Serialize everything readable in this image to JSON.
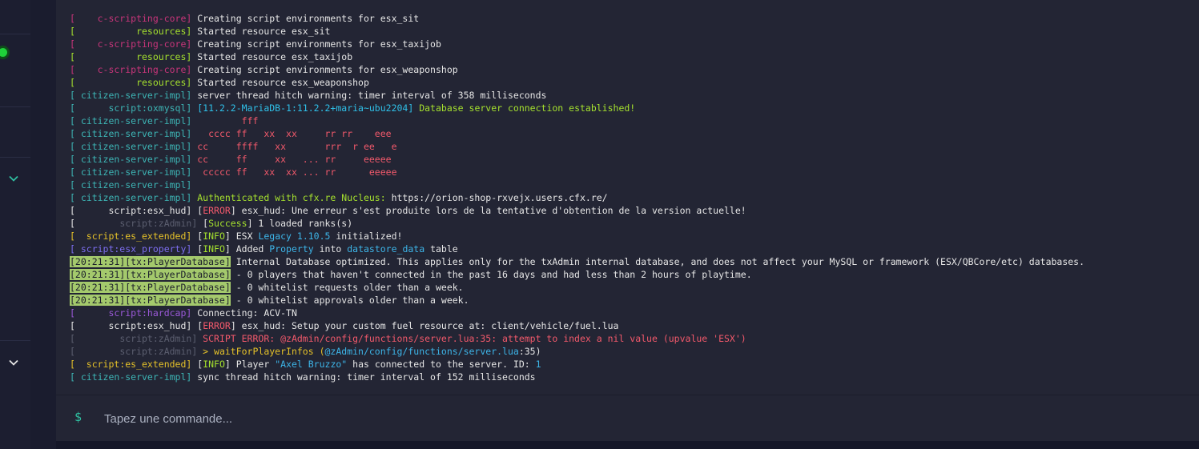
{
  "colors": {
    "background": "#1a1c2e",
    "console_bg": "#232534",
    "status_online": "#1fd13a",
    "tx_badge_bg": "#a4c96c"
  },
  "sidebar": {
    "icons": [
      "status-online-dot",
      "chevron-down-icon",
      "chevron-down-icon"
    ]
  },
  "console": {
    "lines": [
      [
        {
          "t": "[    c-scripting-core]",
          "c": "#c8357a"
        },
        {
          "t": " Creating script environments for esx_sit",
          "c": "#e6e6e6"
        }
      ],
      [
        {
          "t": "[           resources]",
          "c": "#a6e22e"
        },
        {
          "t": " Started resource esx_sit",
          "c": "#e6e6e6"
        }
      ],
      [
        {
          "t": "[    c-scripting-core]",
          "c": "#c8357a"
        },
        {
          "t": " Creating script environments for esx_taxijob",
          "c": "#e6e6e6"
        }
      ],
      [
        {
          "t": "[           resources]",
          "c": "#a6e22e"
        },
        {
          "t": " Started resource esx_taxijob",
          "c": "#e6e6e6"
        }
      ],
      [
        {
          "t": "[    c-scripting-core]",
          "c": "#c8357a"
        },
        {
          "t": " Creating script environments for esx_weaponshop",
          "c": "#e6e6e6"
        }
      ],
      [
        {
          "t": "[           resources]",
          "c": "#a6e22e"
        },
        {
          "t": " Started resource esx_weaponshop",
          "c": "#e6e6e6"
        }
      ],
      [
        {
          "t": "[ citizen-server-impl]",
          "c": "#3db5b5"
        },
        {
          "t": " server thread hitch warning: timer interval of 358 milliseconds",
          "c": "#e6e6e6"
        }
      ],
      [
        {
          "t": "[      script:oxmysql]",
          "c": "#3db5b5"
        },
        {
          "t": " [11.2.2-MariaDB-1:11.2.2+maria~ubu2204]",
          "c": "#2fc0e8"
        },
        {
          "t": " Database server connection established!",
          "c": "#a6e22e"
        }
      ],
      [
        {
          "t": "[ citizen-server-impl]",
          "c": "#3db5b5"
        },
        {
          "t": "         fff",
          "c": "#f2596b"
        }
      ],
      [
        {
          "t": "[ citizen-server-impl]",
          "c": "#3db5b5"
        },
        {
          "t": "   cccc ff   xx  xx     rr rr    eee",
          "c": "#f2596b"
        }
      ],
      [
        {
          "t": "[ citizen-server-impl]",
          "c": "#3db5b5"
        },
        {
          "t": " cc     ffff   xx       rrr  r ee   e",
          "c": "#f2596b"
        }
      ],
      [
        {
          "t": "[ citizen-server-impl]",
          "c": "#3db5b5"
        },
        {
          "t": " cc     ff     xx   ... rr     eeeee",
          "c": "#f2596b"
        }
      ],
      [
        {
          "t": "[ citizen-server-impl]",
          "c": "#3db5b5"
        },
        {
          "t": "  ccccc ff   xx  xx ... rr      eeeee",
          "c": "#f2596b"
        }
      ],
      [
        {
          "t": "[ citizen-server-impl]",
          "c": "#3db5b5"
        }
      ],
      [
        {
          "t": "[ citizen-server-impl]",
          "c": "#3db5b5"
        },
        {
          "t": " Authenticated with cfx.re Nucleus:",
          "c": "#a6e22e"
        },
        {
          "t": " https://orion-shop-rxvejx.users.cfx.re/",
          "c": "#e6e6e6"
        }
      ],
      [
        {
          "t": "[      script:esx_hud]",
          "c": "#e6e6e6"
        },
        {
          "t": " [",
          "c": "#e6e6e6"
        },
        {
          "t": "ERROR",
          "c": "#f2596b"
        },
        {
          "t": "] esx_hud: Une erreur s'est produite lors de la tentative d'obtention de la version actuelle!",
          "c": "#e6e6e6"
        }
      ],
      [
        {
          "t": "[        ",
          "c": "#e6e6e6"
        },
        {
          "t": "script:zAdmin]",
          "c": "#5c5f70"
        },
        {
          "t": " [",
          "c": "#e6e6e6"
        },
        {
          "t": "Success",
          "c": "#a6e22e"
        },
        {
          "t": "] 1 loaded ranks(s)",
          "c": "#e6e6e6"
        }
      ],
      [
        {
          "t": "[  script:es_extended]",
          "c": "#e6c229"
        },
        {
          "t": " [",
          "c": "#e6e6e6"
        },
        {
          "t": "INFO",
          "c": "#a6e22e"
        },
        {
          "t": "] ESX ",
          "c": "#e6e6e6"
        },
        {
          "t": "Legacy 1.10.5",
          "c": "#3db5e8"
        },
        {
          "t": " initialized!",
          "c": "#e6e6e6"
        }
      ],
      [
        {
          "t": "[ script:esx_property]",
          "c": "#7d6ef0"
        },
        {
          "t": " [",
          "c": "#e6e6e6"
        },
        {
          "t": "INFO",
          "c": "#a6e22e"
        },
        {
          "t": "] Added ",
          "c": "#e6e6e6"
        },
        {
          "t": "Property",
          "c": "#3db5e8"
        },
        {
          "t": " into ",
          "c": "#e6e6e6"
        },
        {
          "t": "datastore_data",
          "c": "#3db5e8"
        },
        {
          "t": " table",
          "c": "#e6e6e6"
        }
      ],
      [
        {
          "t": "[20:21:31][tx:PlayerDatabase]",
          "c": "#1b1d2b",
          "bg": "#a4c96c"
        },
        {
          "t": " Internal Database optimized. This applies only for the txAdmin internal database, and does not affect your MySQL or framework (ESX/QBCore/etc) databases.",
          "c": "#e6e6e6"
        }
      ],
      [
        {
          "t": "[20:21:31][tx:PlayerDatabase]",
          "c": "#1b1d2b",
          "bg": "#a4c96c"
        },
        {
          "t": " - 0 players that haven't connected in the past 16 days and had less than 2 hours of playtime.",
          "c": "#e6e6e6"
        }
      ],
      [
        {
          "t": "[20:21:31][tx:PlayerDatabase]",
          "c": "#1b1d2b",
          "bg": "#a4c96c"
        },
        {
          "t": " - 0 whitelist requests older than a week.",
          "c": "#e6e6e6"
        }
      ],
      [
        {
          "t": "[20:21:31][tx:PlayerDatabase]",
          "c": "#1b1d2b",
          "bg": "#a4c96c"
        },
        {
          "t": " - 0 whitelist approvals older than a week.",
          "c": "#e6e6e6"
        }
      ],
      [
        {
          "t": "[      script:hardcap]",
          "c": "#9b59d9"
        },
        {
          "t": " Connecting: ACV-TN",
          "c": "#e6e6e6"
        }
      ],
      [
        {
          "t": "[      script:esx_hud]",
          "c": "#e6e6e6"
        },
        {
          "t": " [",
          "c": "#e6e6e6"
        },
        {
          "t": "ERROR",
          "c": "#f2596b"
        },
        {
          "t": "] esx_hud: Setup your custom fuel resource at: client/vehicle/fuel.lua",
          "c": "#e6e6e6"
        }
      ],
      [
        {
          "t": "[        ",
          "c": "#5c5f70"
        },
        {
          "t": "script:zAdmin]",
          "c": "#5c5f70"
        },
        {
          "t": " SCRIPT ERROR: @zAdmin/config/functions/server.lua:35: attempt to index a nil value (upvalue 'ESX')",
          "c": "#f2596b"
        }
      ],
      [
        {
          "t": "[        ",
          "c": "#5c5f70"
        },
        {
          "t": "script:zAdmin]",
          "c": "#5c5f70"
        },
        {
          "t": " > waitForPlayerInfos (",
          "c": "#e6c229"
        },
        {
          "t": "@zAdmin/config/functions/server.lua",
          "c": "#3db5e8"
        },
        {
          "t": ":35)",
          "c": "#e6e6e6"
        }
      ],
      [
        {
          "t": "[  script:es_extended]",
          "c": "#e6c229"
        },
        {
          "t": " [",
          "c": "#e6e6e6"
        },
        {
          "t": "INFO",
          "c": "#a6e22e"
        },
        {
          "t": "] Player ",
          "c": "#e6e6e6"
        },
        {
          "t": "\"Axel Bruzzo\"",
          "c": "#3db5e8"
        },
        {
          "t": " has connected to the server. ID: ",
          "c": "#e6e6e6"
        },
        {
          "t": "1",
          "c": "#3db5e8"
        }
      ],
      [
        {
          "t": "[ citizen-server-impl]",
          "c": "#3db5b5"
        },
        {
          "t": " sync thread hitch warning: timer interval of 152 milliseconds",
          "c": "#e6e6e6"
        }
      ]
    ]
  },
  "command_bar": {
    "prompt_symbol": "$",
    "placeholder": "Tapez une commande..."
  }
}
